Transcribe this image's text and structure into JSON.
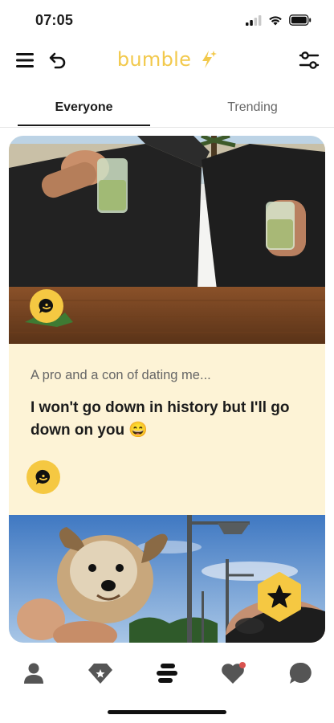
{
  "status_bar": {
    "time": "07:05",
    "icons": [
      "signal-icon",
      "wifi-icon",
      "battery-icon"
    ]
  },
  "header": {
    "menu_icon": "menu-icon",
    "back_icon": "undo-icon",
    "logo": "bumble",
    "filter_icon": "filter-sliders-icon"
  },
  "tabs": {
    "items": [
      {
        "label": "Everyone",
        "active": true
      },
      {
        "label": "Trending",
        "active": false
      }
    ]
  },
  "card": {
    "prompt_question": "A pro and a con of dating me...",
    "prompt_answer": "I won't go down in history but I'll go down on you 😄",
    "comment_icon": "comment-icon",
    "superswipe_icon": "star-icon"
  },
  "bottom_nav": {
    "items": [
      "profile-icon",
      "diamond-icon",
      "feed-icon",
      "likes-icon",
      "chat-icon"
    ],
    "notification_dot_color": "#d9534f"
  },
  "colors": {
    "brand_yellow": "#f5c842",
    "logo_yellow": "#f2c94c",
    "card_background": "#fdf3d6",
    "text_primary": "#1c1c1c",
    "text_secondary": "#666666"
  }
}
